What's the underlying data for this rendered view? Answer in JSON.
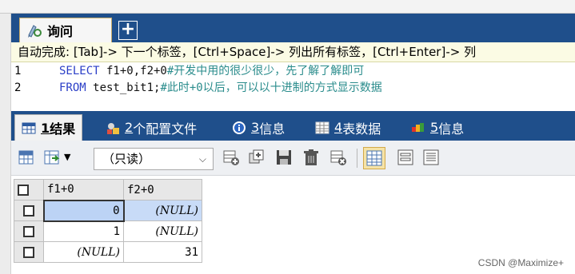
{
  "query_tab": {
    "label": "询问",
    "new_tab_symbol": "+"
  },
  "editor": {
    "autocomplete": "自动完成: [Tab]-> 下一个标签，[Ctrl+Space]-> 列出所有标签，[Ctrl+Enter]-> 列",
    "lines": [
      {
        "num": "1",
        "kw": "SELECT",
        "code": " f1+0,f2+0",
        "comment": "#开发中用的很少很少，先了解了解即可"
      },
      {
        "num": "2",
        "kw": "FROM",
        "code": " test_bit1;",
        "comment": "#此时+0以后，可以以十进制的方式显示数据"
      }
    ]
  },
  "result_tabs": [
    {
      "num": "1",
      "label": " 结果",
      "icon": "result-grid-icon",
      "active": true
    },
    {
      "num": "2",
      "label": " 个配置文件",
      "icon": "profile-icon",
      "active": false
    },
    {
      "num": "3",
      "label": " 信息",
      "icon": "info-icon",
      "active": false
    },
    {
      "num": "4",
      "label": " 表数据",
      "icon": "table-data-icon",
      "active": false
    },
    {
      "num": "5",
      "label": " 信息",
      "icon": "info-blocks-icon",
      "active": false
    }
  ],
  "toolbar": {
    "mode_select": "（只读）"
  },
  "grid": {
    "columns": [
      "f1+0",
      "f2+0"
    ],
    "rows": [
      [
        "0",
        "(NULL)"
      ],
      [
        "1",
        "(NULL)"
      ],
      [
        "(NULL)",
        "31"
      ]
    ]
  },
  "watermark": "CSDN @Maximize+"
}
